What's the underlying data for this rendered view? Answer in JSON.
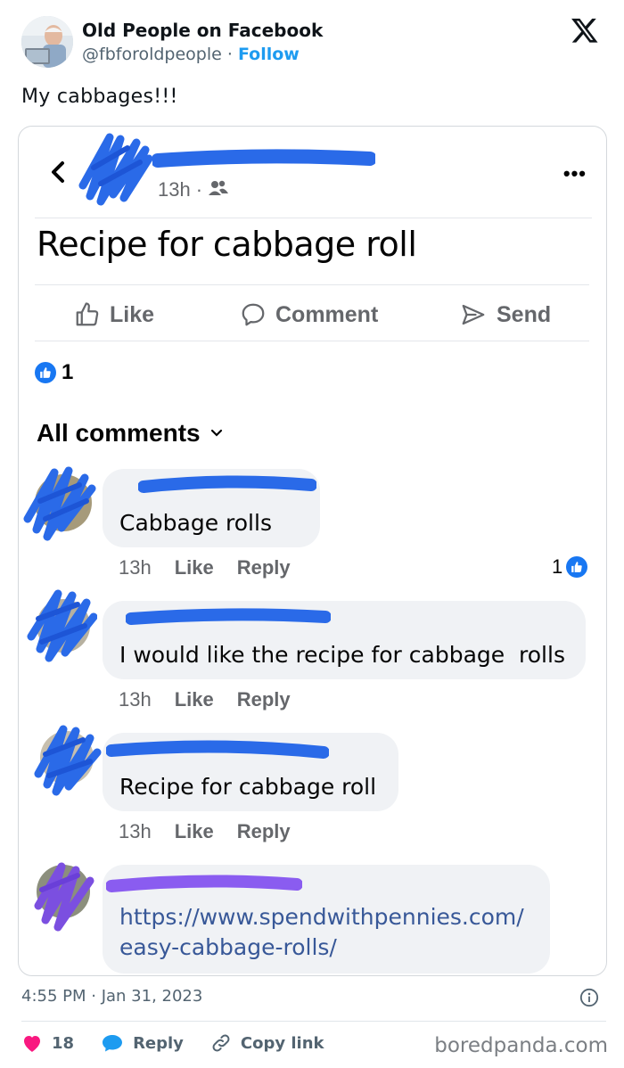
{
  "tweet": {
    "author_name": "Old People on Facebook",
    "handle": "@fbforoldpeople",
    "separator": "·",
    "follow_label": "Follow",
    "text": "My cabbages!!!",
    "timestamp": "4:55 PM · Jan 31, 2023",
    "likes_count": "18",
    "reply_label": "Reply",
    "copy_link_label": "Copy link",
    "watermark": "boredpanda.com",
    "colors": {
      "accent": "#1d9bf0",
      "heart": "#f91880",
      "muted": "#536471"
    }
  },
  "fb_post": {
    "time": "13h",
    "time_dot": "·",
    "title": "Recipe for cabbage roll",
    "more_icon": "more-dots-icon",
    "actions": {
      "like": "Like",
      "comment": "Comment",
      "send": "Send"
    },
    "reaction_count": "1",
    "all_comments_label": "All comments",
    "colors": {
      "link": "#385898",
      "like_blue": "#1877f2",
      "bubble": "#f0f2f5"
    }
  },
  "comments": [
    {
      "text": "Cabbage rolls",
      "time": "13h",
      "like": "Like",
      "reply": "Reply",
      "reactions": "1"
    },
    {
      "text": "I would like the recipe for cabbage  rolls",
      "time": "13h",
      "like": "Like",
      "reply": "Reply"
    },
    {
      "text": "Recipe for cabbage roll",
      "time": "13h",
      "like": "Like",
      "reply": "Reply"
    },
    {
      "link_line1": "https://www.spendwithpennies.com/",
      "link_line2": "easy-cabbage-rolls/"
    }
  ]
}
